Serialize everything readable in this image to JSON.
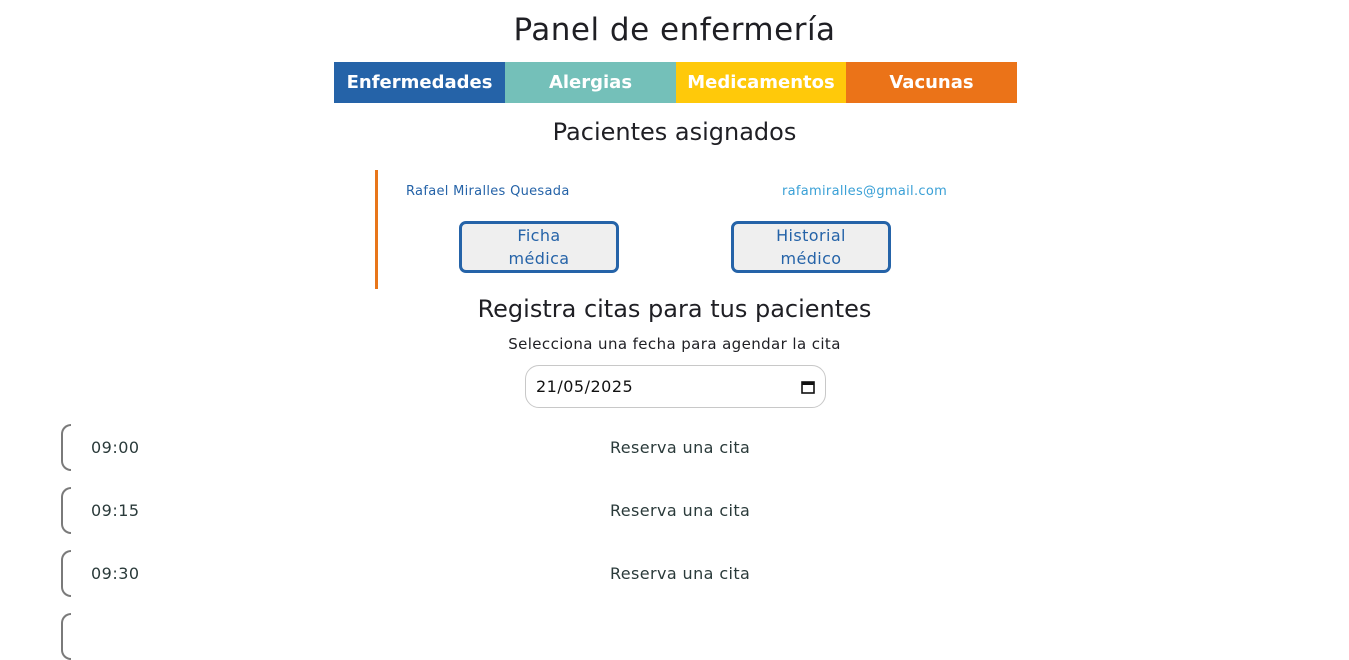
{
  "page": {
    "title": "Panel de enfermería"
  },
  "tabs": [
    {
      "label": "Enfermedades",
      "color": "#2563a8"
    },
    {
      "label": "Alergias",
      "color": "#74c0b9"
    },
    {
      "label": "Medicamentos",
      "color": "#ffc90a"
    },
    {
      "label": "Vacunas",
      "color": "#eb7318"
    }
  ],
  "assigned": {
    "title": "Pacientes asignados",
    "patients": [
      {
        "name": "Rafael Miralles Quesada",
        "email": "rafamiralles@gmail.com",
        "ficha_button": "Ficha médica",
        "historial_button": "Historial médico"
      }
    ]
  },
  "appointments": {
    "title": "Registra citas para tus pacientes",
    "date_hint": "Selecciona una fecha para agendar la cita",
    "date_value": "21/05/2025",
    "calendar_icon": "calendar-icon",
    "slots": [
      {
        "time": "09:00",
        "action": "Reserva una cita"
      },
      {
        "time": "09:15",
        "action": "Reserva una cita"
      },
      {
        "time": "09:30",
        "action": "Reserva una cita"
      },
      {
        "time": "",
        "action": ""
      }
    ]
  },
  "colors": {
    "primary_blue": "#2563a8",
    "accent_orange": "#e8761a",
    "email_blue": "#3aa0d6"
  }
}
